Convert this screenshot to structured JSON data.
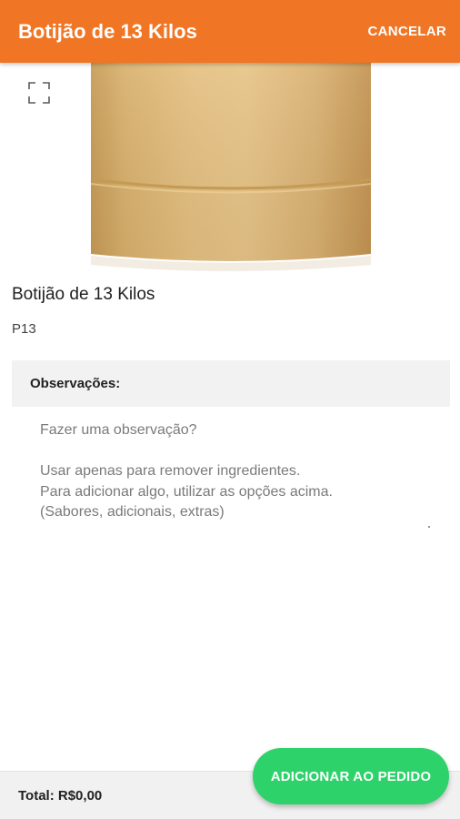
{
  "appbar": {
    "title": "Botijão de 13 Kilos",
    "cancel_label": "CANCELAR"
  },
  "product": {
    "image_icon": "gas-cylinder-image",
    "expand_icon": "fullscreen-icon",
    "name": "Botijão de 13 Kilos",
    "code": "P13"
  },
  "observations": {
    "header": "Observações:",
    "value": "",
    "placeholder": "Fazer uma observação?\n\nUsar apenas para remover ingredientes.\nPara adicionar algo, utilizar as opções acima.\n(Sabores, adicionais, extras)"
  },
  "footer": {
    "total_label": "Total: R$0,00",
    "add_button_label": "ADICIONAR AO PEDIDO"
  },
  "colors": {
    "appbar": "#f07524",
    "fab": "#2ed26a",
    "section_bg": "#f2f2f2",
    "footer_bg": "#f1f1f1"
  }
}
